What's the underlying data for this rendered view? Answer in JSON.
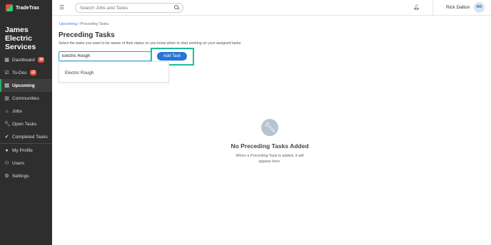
{
  "app": {
    "logo_text": "TradeTrax",
    "company_name": "James Electric Services"
  },
  "sidebar": {
    "items": [
      {
        "label": "Dashboard",
        "icon": "dashboard-icon",
        "badge": "10"
      },
      {
        "label": "To-Dos",
        "icon": "todo-icon",
        "badge": "12"
      },
      {
        "label": "Upcoming",
        "icon": "calendar-icon",
        "active": true
      },
      {
        "label": "Communities",
        "icon": "building-icon"
      },
      {
        "label": "Jobs",
        "icon": "house-icon"
      },
      {
        "label": "Open Tasks",
        "icon": "wrench-icon"
      },
      {
        "label": "Completed Tasks",
        "icon": "check-circle-icon"
      },
      {
        "label": "My Profile",
        "icon": "user-circle-icon"
      },
      {
        "label": "Users",
        "icon": "users-icon"
      },
      {
        "label": "Settings",
        "icon": "gear-icon"
      }
    ]
  },
  "topbar": {
    "search_placeholder": "Search Jobs and Tasks",
    "user_name": "Rick Dalton",
    "user_initials": "RD"
  },
  "breadcrumb": {
    "link": "Upcoming",
    "separator": " / ",
    "current": "Preceding Tasks"
  },
  "page": {
    "title": "Preceding Tasks",
    "subtitle": "Select the tasks you want to be aware of their status so you know when to start working on your assigned tasks."
  },
  "task_input": {
    "value": "Electric Rough"
  },
  "add_button": "Add Task",
  "dropdown": {
    "options": [
      "Electric Rough"
    ]
  },
  "empty_state": {
    "title": "No Preceding Tasks Added",
    "text": "When a Preceding Task is added, it will appear here."
  },
  "colors": {
    "sidebar_bg": "#2e2e2e",
    "accent_green": "#27ae60",
    "primary_blue": "#2475d6",
    "highlight": "#1abc9c",
    "badge_red": "#e74c3c"
  }
}
